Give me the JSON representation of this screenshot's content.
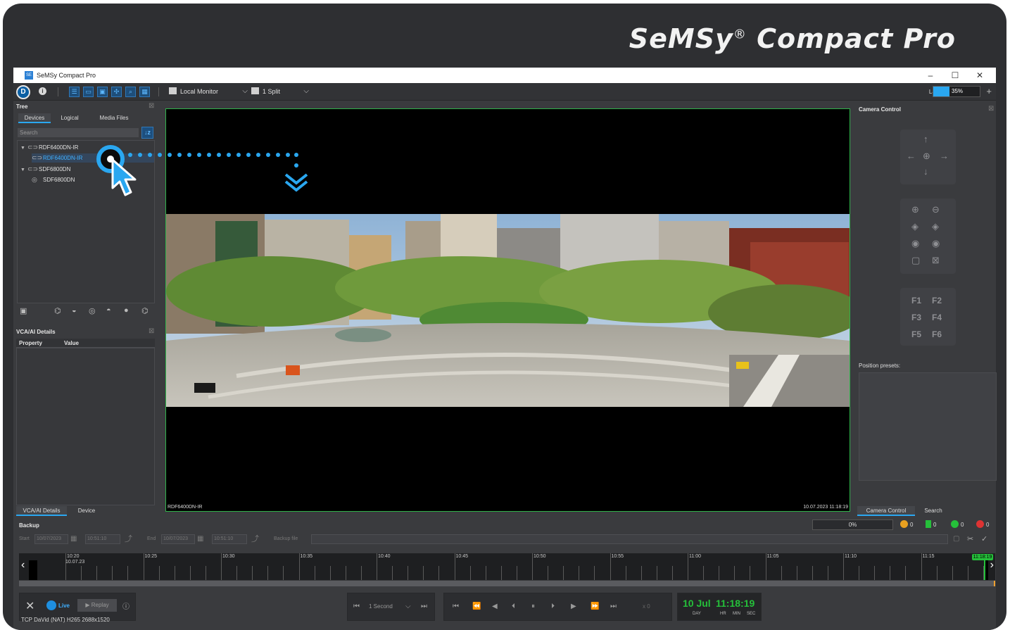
{
  "brand": {
    "name": "SeMSy",
    "reg": "®",
    "product": "Compact Pro"
  },
  "window": {
    "title": "SeMSy Compact Pro",
    "app_icon": "semsy-app-icon",
    "controls": [
      "–",
      "☐",
      "✕"
    ]
  },
  "toolbar": {
    "monitor": "Local Monitor",
    "split": "1 Split",
    "last_label": "Last",
    "last_value": "35%",
    "last_fraction": 0.35,
    "plus": "+"
  },
  "tree": {
    "title": "Tree",
    "tabs": [
      "Devices",
      "Logical",
      "Media Files"
    ],
    "search_placeholder": "Search",
    "items": [
      {
        "label": "RDF6400DN-IR",
        "level": 0,
        "expanded": true
      },
      {
        "label": "RDF6400DN-IR",
        "level": 1,
        "selected": true
      },
      {
        "label": "SDF6800DN",
        "level": 0,
        "expanded": true
      },
      {
        "label": "SDF6800DN",
        "level": 1
      }
    ]
  },
  "vca": {
    "title": "VCA/AI Details",
    "col_property": "Property",
    "col_value": "Value",
    "bottom_tabs": [
      "VCA/AI Details",
      "Device"
    ]
  },
  "video": {
    "camera_name": "RDF6400DN-IR",
    "timestamp": "10.07.2023 11:18:19"
  },
  "camera_control": {
    "title": "Camera Control",
    "fkeys": [
      "F1",
      "F2",
      "F3",
      "F4",
      "F5",
      "F6"
    ],
    "presets_label": "Position presets:",
    "bottom_tabs": [
      "Camera Control",
      "Search"
    ]
  },
  "backup": {
    "title": "Backup",
    "progress": "0%",
    "start_label": "Start",
    "start_date": "10/07/2023",
    "start_time": "10:51:10",
    "end_label": "End",
    "end_date": "10/07/2023",
    "end_time": "10:51:10",
    "backup_file_label": "Backup file",
    "counters": {
      "pending": "0",
      "running": "0",
      "ok": "0",
      "failed": "0"
    }
  },
  "timeline": {
    "labels": [
      "10:20",
      "10:25",
      "10:30",
      "10:35",
      "10:40",
      "10:45",
      "10:50",
      "10:55",
      "11:00",
      "11:05",
      "11:10",
      "11:15"
    ],
    "date_label": "10.07.23",
    "now_label": "11:18:19"
  },
  "playback": {
    "live_label": "Live",
    "replay_label": "Replay",
    "codec_info": "TCP DaVid (NAT) H265 2688x1520",
    "interval": "1 Second",
    "speed": "x 0",
    "date": "10 Jul",
    "time": "11:18:19",
    "unit_day": "DAY",
    "unit_hr": "HR",
    "unit_min": "MIN",
    "unit_sec": "SEC"
  },
  "colors": {
    "accent": "#2aa7f0",
    "live_green": "#25c03a",
    "video_border": "#2fb24a",
    "background": "#2e2f32"
  }
}
